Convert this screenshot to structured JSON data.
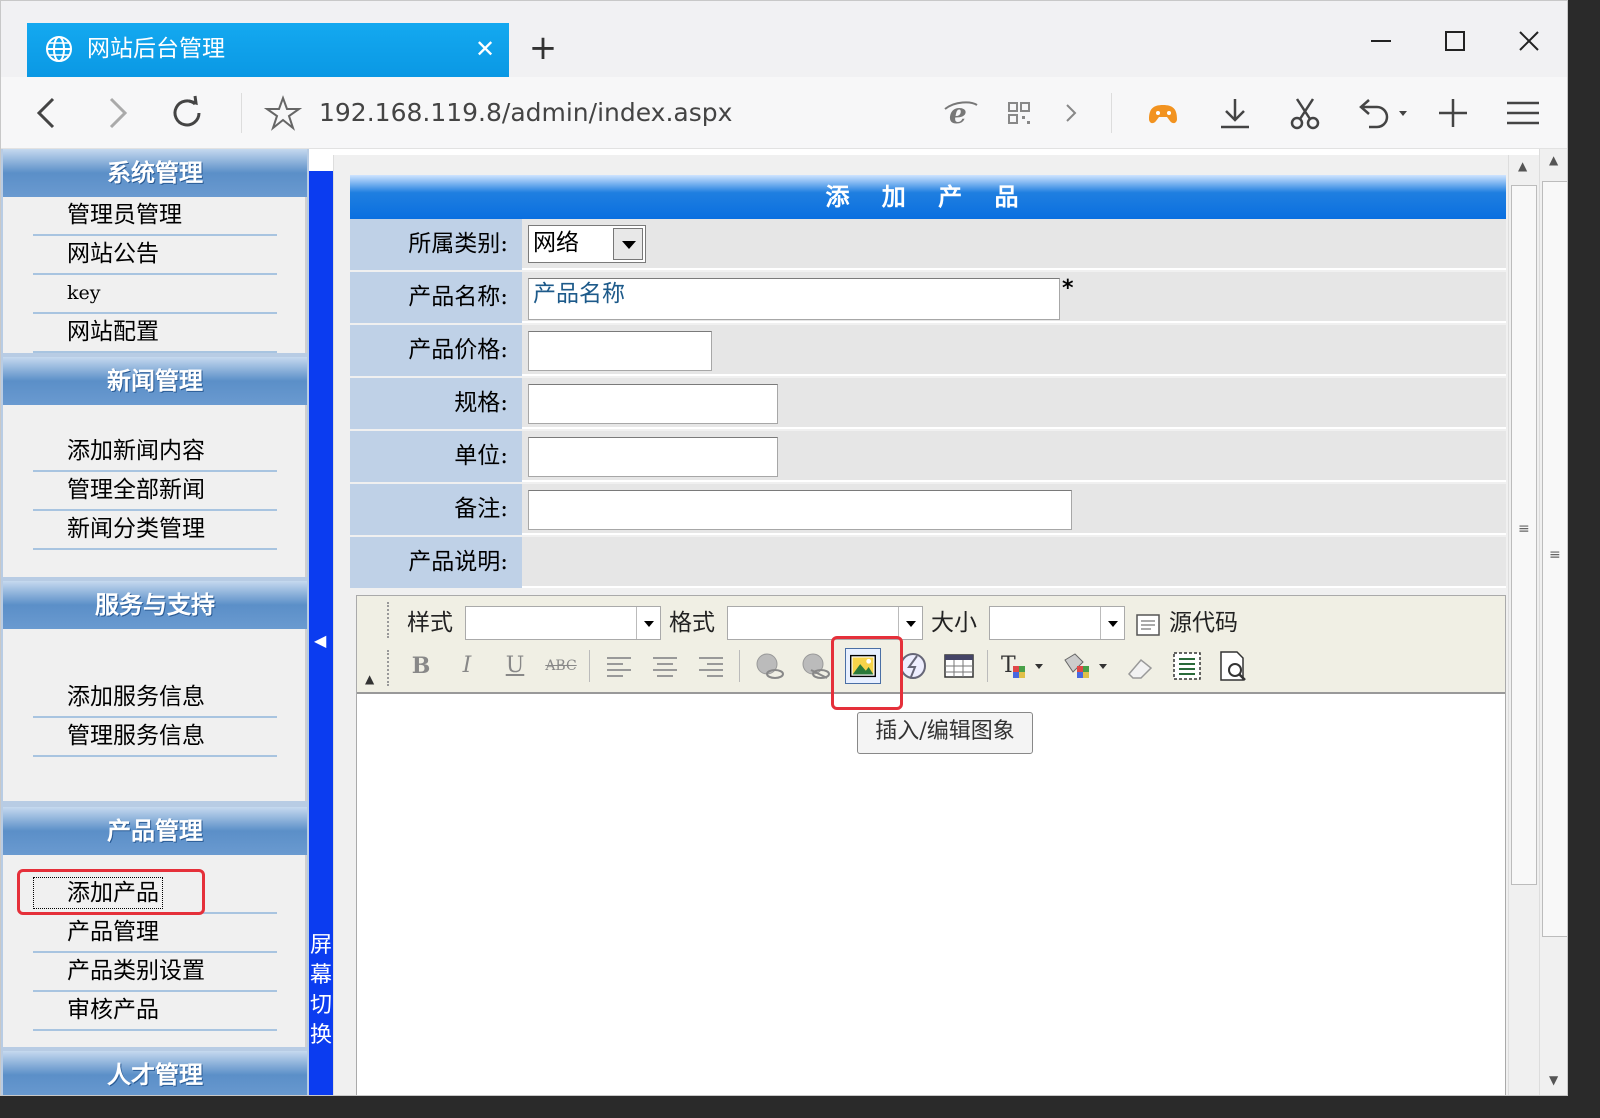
{
  "browser": {
    "tab_title": "网站后台管理",
    "url": "192.168.119.8/admin/index.aspx"
  },
  "sidebar": {
    "sections": [
      {
        "title": "系统管理",
        "items": [
          "管理员管理",
          "网站公告",
          "key",
          "网站配置"
        ]
      },
      {
        "title": "新闻管理",
        "items": [
          "添加新闻内容",
          "管理全部新闻",
          "新闻分类管理"
        ]
      },
      {
        "title": "服务与支持",
        "items": [
          "添加服务信息",
          "管理服务信息"
        ]
      },
      {
        "title": "产品管理",
        "items": [
          "添加产品",
          "产品管理",
          "产品类别设置",
          "审核产品"
        ]
      },
      {
        "title": "人才管理",
        "items": []
      }
    ],
    "splitter_label": "屏幕切换"
  },
  "form": {
    "title": "添 加 产 品",
    "category_label": "所属类别:",
    "category_value": "网络",
    "name_label": "产品名称:",
    "name_value": "产品名称",
    "required_mark": "*",
    "price_label": "产品价格:",
    "spec_label": "规格:",
    "unit_label": "单位:",
    "note_label": "备注:",
    "desc_label": "产品说明:"
  },
  "editor": {
    "style_label": "样式",
    "format_label": "格式",
    "size_label": "大小",
    "source_label": "源代码",
    "bold": "B",
    "italic": "I",
    "underline": "U",
    "strike": "ABC",
    "tooltip": "插入/编辑图象"
  },
  "colors": {
    "tab_blue": "#0ea5e9",
    "header_blue": "#0a6fe0",
    "splitter_blue": "#0b3cf0",
    "highlight_red": "#e5303a"
  }
}
